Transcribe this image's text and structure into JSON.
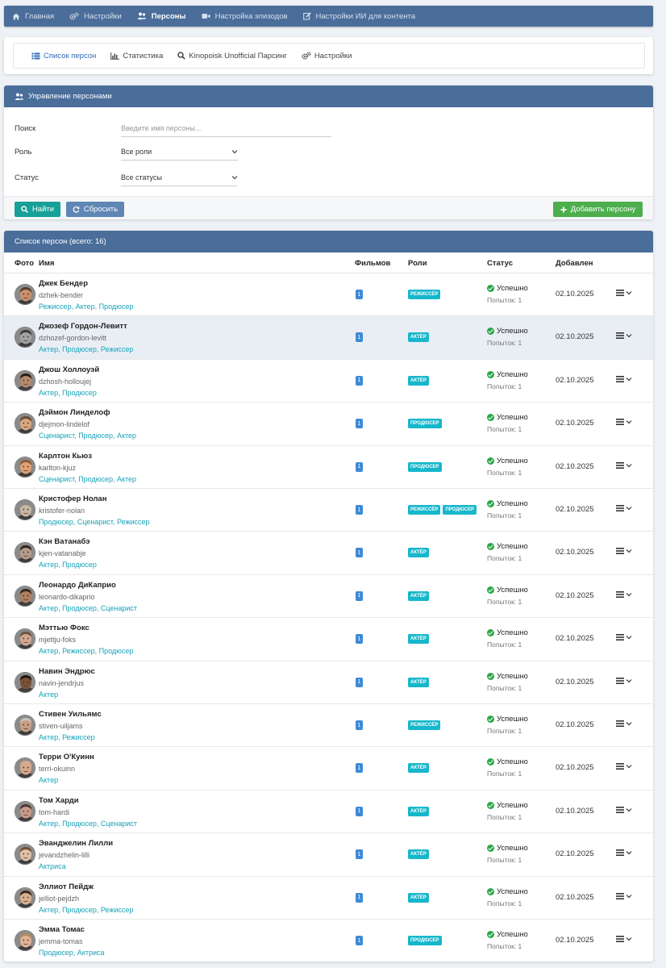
{
  "topnav": {
    "items": [
      {
        "label": "Главная",
        "icon": "home-icon",
        "active": false
      },
      {
        "label": "Настройки",
        "icon": "gears-icon",
        "active": false
      },
      {
        "label": "Персоны",
        "icon": "users-icon",
        "active": true
      },
      {
        "label": "Настройка эпизодов",
        "icon": "video-camera-icon",
        "active": false
      },
      {
        "label": "Настройки ИИ для контента",
        "icon": "edit-icon",
        "active": false
      }
    ]
  },
  "tabs": [
    {
      "label": "Список персон",
      "icon": "list-icon",
      "active": true
    },
    {
      "label": "Статистика",
      "icon": "bar-chart-icon",
      "active": false
    },
    {
      "label": "Kinopoisk Unofficial Парсинг",
      "icon": "search-icon",
      "active": false
    },
    {
      "label": "Настройки",
      "icon": "gears-icon",
      "active": false
    }
  ],
  "management": {
    "title": "Управление персонами",
    "search_label": "Поиск",
    "search_placeholder": "Введите имя персоны...",
    "role_label": "Роль",
    "role_value": "Все роли",
    "status_label": "Статус",
    "status_value": "Все статусы",
    "find_button": "Найти",
    "reset_button": "Сбросить",
    "add_button": "Добавить персону"
  },
  "list": {
    "title": "Список персон (всего: 16)",
    "columns": {
      "photo": "Фото",
      "name": "Имя",
      "films": "Фильмов",
      "roles": "Роли",
      "status": "Статус",
      "added": "Добавлен"
    },
    "rows": [
      {
        "name": "Джек Бендер",
        "slug": "dzhek-bender",
        "roles_text": "Режиссер, Актер, Продюсер",
        "films": "1",
        "role_badges": [
          "РЕЖИССЁР"
        ],
        "status": "Успешно",
        "attempts": "Попыток: 1",
        "date": "02.10.2025",
        "skin": "#c9926e",
        "hair": "#5a4032"
      },
      {
        "name": "Джозеф Гордон-Левитт",
        "slug": "dzhozef-gordon-levitt",
        "roles_text": "Актер, Продюсер, Режиссер",
        "films": "1",
        "role_badges": [
          "АКТЁР"
        ],
        "status": "Успешно",
        "attempts": "Попыток: 1",
        "date": "02.10.2025",
        "skin": "#a3a3a3",
        "hair": "#3a3a3a",
        "highlight": true
      },
      {
        "name": "Джош Холлоуэй",
        "slug": "dzhosh-holloujej",
        "roles_text": "Актер, Продюсер",
        "films": "1",
        "role_badges": [
          "АКТЁР"
        ],
        "status": "Успешно",
        "attempts": "Попыток: 1",
        "date": "02.10.2025",
        "skin": "#b58a6c",
        "hair": "#2a1c14"
      },
      {
        "name": "Дэймон Линделоф",
        "slug": "djejmon-lindelof",
        "roles_text": "Сценарист, Продюсер, Актер",
        "films": "1",
        "role_badges": [
          "ПРОДЮСЕР"
        ],
        "status": "Успешно",
        "attempts": "Попыток: 1",
        "date": "02.10.2025",
        "skin": "#d9a77f",
        "hair": "#6b4a33"
      },
      {
        "name": "Карлтон Кьюз",
        "slug": "karlton-kjuz",
        "roles_text": "Сценарист, Продюсер, Актер",
        "films": "1",
        "role_badges": [
          "ПРОДЮСЕР"
        ],
        "status": "Успешно",
        "attempts": "Попыток: 1",
        "date": "02.10.2025",
        "skin": "#e0a072",
        "hair": "#8a5c3a"
      },
      {
        "name": "Кристофер Нолан",
        "slug": "kristofer-nolan",
        "roles_text": "Продюсер, Сценарист, Режиссер",
        "films": "1",
        "role_badges": [
          "РЕЖИССЁР",
          "ПРОДЮСЕР"
        ],
        "status": "Успешно",
        "attempts": "Попыток: 1",
        "date": "02.10.2025",
        "skin": "#c7b7a3",
        "hair": "#8c8c8c"
      },
      {
        "name": "Кэн Ватанабэ",
        "slug": "kjen-vatanabje",
        "roles_text": "Актер, Продюсер",
        "films": "1",
        "role_badges": [
          "АКТЁР"
        ],
        "status": "Успешно",
        "attempts": "Попыток: 1",
        "date": "02.10.2025",
        "skin": "#b59a88",
        "hair": "#2e2624"
      },
      {
        "name": "Леонардо ДиКаприо",
        "slug": "leonardo-dikaprio",
        "roles_text": "Актер, Продюсер, Сценарист",
        "films": "1",
        "role_badges": [
          "АКТЁР"
        ],
        "status": "Успешно",
        "attempts": "Попыток: 1",
        "date": "02.10.2025",
        "skin": "#b07e60",
        "hair": "#3a2a1c"
      },
      {
        "name": "Мэттью Фокс",
        "slug": "mjettju-foks",
        "roles_text": "Актер, Режиссер, Продюсер",
        "films": "1",
        "role_badges": [
          "АКТЁР"
        ],
        "status": "Успешно",
        "attempts": "Попыток: 1",
        "date": "02.10.2025",
        "skin": "#d2a892",
        "hair": "#6e5244"
      },
      {
        "name": "Навин Эндрюс",
        "slug": "navin-jendrjus",
        "roles_text": "Актер",
        "films": "1",
        "role_badges": [
          "АКТЁР"
        ],
        "status": "Успешно",
        "attempts": "Попыток: 1",
        "date": "02.10.2025",
        "skin": "#7a5238",
        "hair": "#1e140e"
      },
      {
        "name": "Стивен Уильямс",
        "slug": "stiven-uiljams",
        "roles_text": "Актер, Режиссер",
        "films": "1",
        "role_badges": [
          "РЕЖИССЁР"
        ],
        "status": "Успешно",
        "attempts": "Попыток: 1",
        "date": "02.10.2025",
        "skin": "#c89f86",
        "hair": "#ccc2b8"
      },
      {
        "name": "Терри О'Куинн",
        "slug": "terri-okuinn",
        "roles_text": "Актер",
        "films": "1",
        "role_badges": [
          "АКТЁР"
        ],
        "status": "Успешно",
        "attempts": "Попыток: 1",
        "date": "02.10.2025",
        "skin": "#d6a88c",
        "hair": "#d6a88c"
      },
      {
        "name": "Том Харди",
        "slug": "tom-hardi",
        "roles_text": "Актер, Продюсер, Сценарист",
        "films": "1",
        "role_badges": [
          "АКТЁР"
        ],
        "status": "Успешно",
        "attempts": "Попыток: 1",
        "date": "02.10.2025",
        "skin": "#c99a8a",
        "hair": "#4a3a33"
      },
      {
        "name": "Эванджелин Лилли",
        "slug": "jevandzhelin-lilli",
        "roles_text": "Актриса",
        "films": "1",
        "role_badges": [
          "АКТЁР"
        ],
        "status": "Успешно",
        "attempts": "Попыток: 1",
        "date": "02.10.2025",
        "skin": "#e0c0a8",
        "hair": "#6e5038"
      },
      {
        "name": "Эллиот Пейдж",
        "slug": "jelliot-pejdzh",
        "roles_text": "Актер, Продюсер, Режиссер",
        "films": "1",
        "role_badges": [
          "АКТЁР"
        ],
        "status": "Успешно",
        "attempts": "Попыток: 1",
        "date": "02.10.2025",
        "skin": "#d8b08e",
        "hair": "#3a281c"
      },
      {
        "name": "Эмма Томас",
        "slug": "jemma-tomas",
        "roles_text": "Продюсер, Актриса",
        "films": "1",
        "role_badges": [
          "ПРОДЮСЕР"
        ],
        "status": "Успешно",
        "attempts": "Попыток: 1",
        "date": "02.10.2025",
        "skin": "#e2b396",
        "hair": "#b88a5e"
      }
    ]
  },
  "colors": {
    "header": "#4a6d9a",
    "teal": "#17a097",
    "reset": "#5f86b4",
    "add": "#4cae4c",
    "badge": "#16b7cc",
    "films": "#3e8ad6",
    "success": "#28a745",
    "link": "#17a2b8"
  }
}
